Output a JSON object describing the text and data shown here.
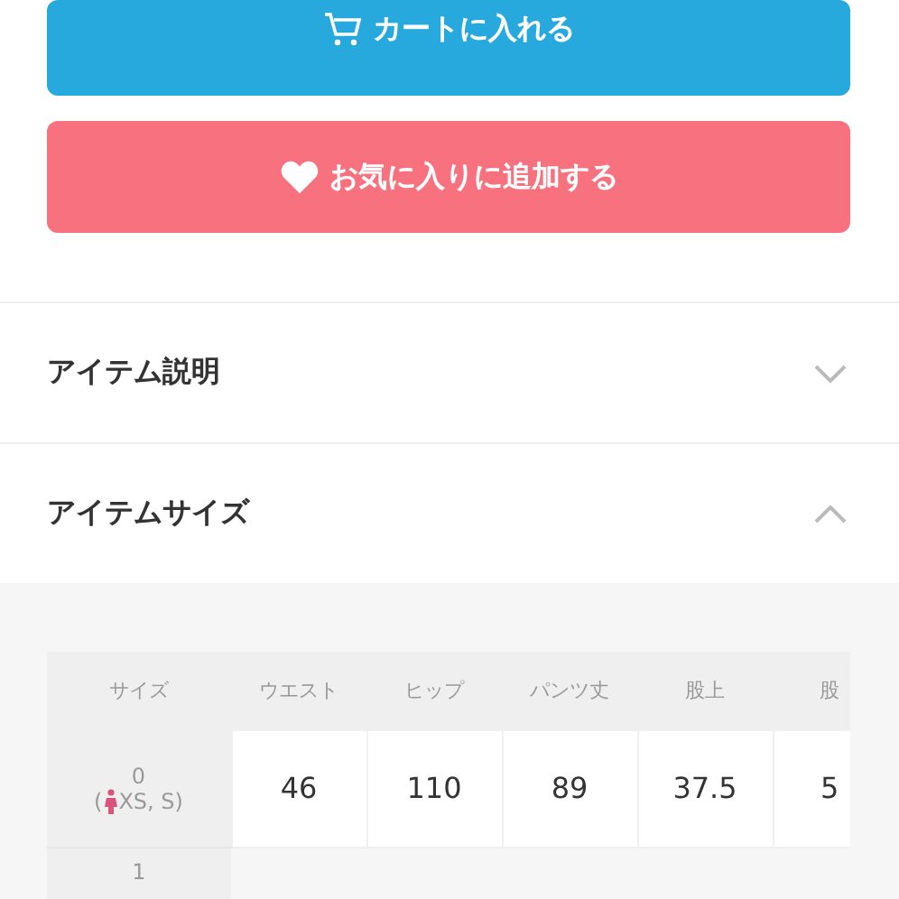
{
  "buttons": [
    {
      "kind": "cart",
      "label": "カートに入れる"
    },
    {
      "kind": "favorite",
      "label": "お気に入りに追加する"
    }
  ],
  "accordion": [
    {
      "title": "アイテム説明",
      "expanded": false
    },
    {
      "title": "アイテムサイズ",
      "expanded": true
    }
  ],
  "size_table": {
    "size_header": "サイズ",
    "columns": [
      "ウエスト",
      "ヒップ",
      "パンツ丈",
      "股上",
      "股"
    ],
    "rows": [
      {
        "size": "0",
        "fit_open": "(",
        "fit": "XS, S)",
        "cells": [
          "46",
          "110",
          "89",
          "37.5",
          "5"
        ]
      },
      {
        "size": "1",
        "cells": []
      }
    ]
  }
}
